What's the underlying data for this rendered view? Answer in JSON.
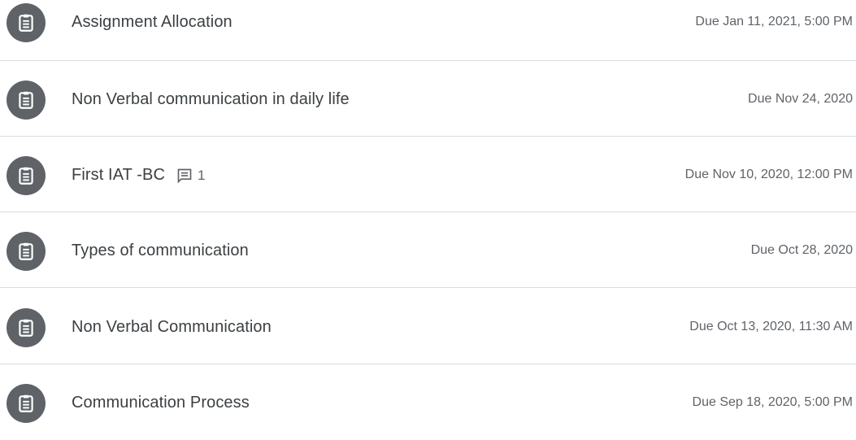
{
  "assignments": [
    {
      "title": "Assignment Allocation",
      "due": "Due Jan 11, 2021, 5:00 PM",
      "comments": null,
      "icon": "assignment-icon"
    },
    {
      "title": "Non Verbal communication in daily life",
      "due": "Due Nov 24, 2020",
      "comments": null,
      "icon": "assignment-icon"
    },
    {
      "title": "First IAT -BC",
      "due": "Due Nov 10, 2020, 12:00 PM",
      "comments": "1",
      "icon": "assignment-icon"
    },
    {
      "title": "Types of communication",
      "due": "Due Oct 28, 2020",
      "comments": null,
      "icon": "assignment-icon"
    },
    {
      "title": "Non Verbal Communication",
      "due": "Due Oct 13, 2020, 11:30 AM",
      "comments": null,
      "icon": "assignment-icon"
    },
    {
      "title": "Communication Process",
      "due": "Due Sep 18, 2020, 5:00 PM",
      "comments": null,
      "icon": "assignment-icon"
    }
  ],
  "colors": {
    "icon_bg": "#5f6368",
    "title": "#3c4043",
    "due": "#5f6368",
    "divider": "#dadce0"
  }
}
